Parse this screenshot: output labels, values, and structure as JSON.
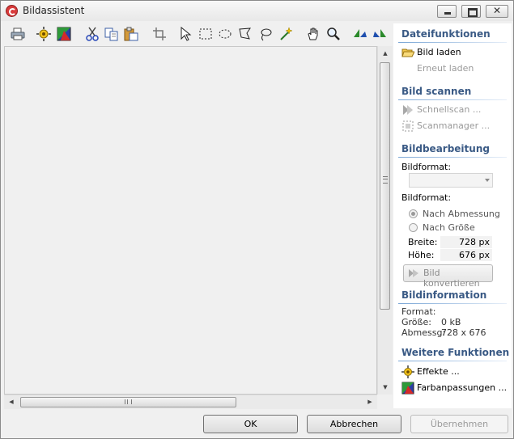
{
  "window": {
    "title": "Bildassistent"
  },
  "toolbar": {
    "icons": [
      "print-icon",
      "effects-icon",
      "color-adjust-icon",
      "scissors-icon",
      "copy-icon",
      "paste-icon",
      "crop-icon",
      "pointer-icon",
      "rect-select-icon",
      "ellipse-select-icon",
      "polygon-select-icon",
      "lasso-icon",
      "magic-wand-icon",
      "hand-icon",
      "zoom-icon",
      "rotate-left-icon",
      "rotate-right-icon"
    ]
  },
  "panel": {
    "file": {
      "title": "Dateifunktionen",
      "load": "Bild laden",
      "reload": "Erneut laden"
    },
    "scan": {
      "title": "Bild scannen",
      "quick": "Schnellscan ...",
      "manager": "Scanmanager ..."
    },
    "edit": {
      "title": "Bildbearbeitung",
      "format_label_1": "Bildformat:",
      "format_value": "",
      "format_label_2": "Bildformat:",
      "by_dimension": "Nach Abmessung",
      "by_size": "Nach Größe",
      "width_label": "Breite:",
      "width_value": "728 px",
      "height_label": "Höhe:",
      "height_value": "676 px",
      "convert": "Bild konvertieren"
    },
    "info": {
      "title": "Bildinformation",
      "format": "Format:",
      "size_label": "Größe:",
      "size_value": "0 kB",
      "dimension_label": "Abmessg:",
      "dimension_value": "728 x 676"
    },
    "more": {
      "title": "Weitere Funktionen",
      "effects": "Effekte ...",
      "color": "Farbanpassungen ..."
    }
  },
  "buttons": {
    "ok": "OK",
    "cancel": "Abbrechen",
    "apply": "Übernehmen"
  },
  "colors": {
    "section_title": "#3a5a85",
    "accent_line": "#7aa6d6",
    "disabled": "#9a9a9a"
  }
}
